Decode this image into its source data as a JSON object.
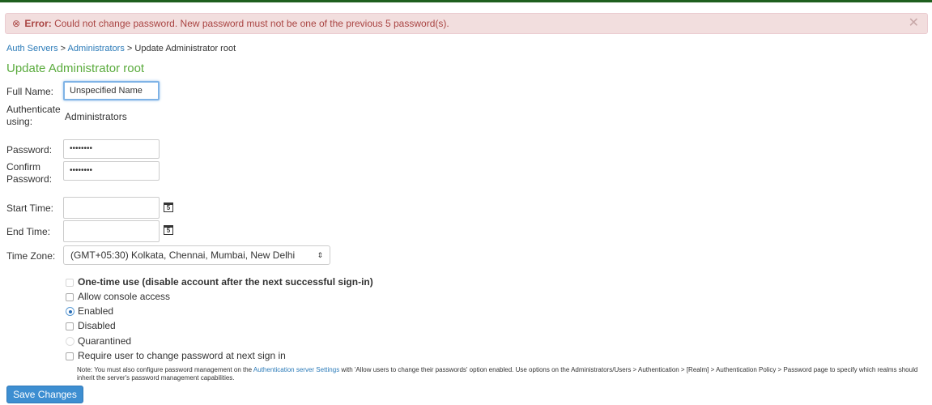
{
  "error": {
    "icon": "error-circle-icon",
    "prefix": "Error:",
    "message": "Could not change password. New password must not be one of the previous 5 password(s).",
    "close_icon": "close-icon"
  },
  "breadcrumb": {
    "items": [
      "Auth Servers",
      "Administrators"
    ],
    "separator": ">",
    "current": "Update Administrator root"
  },
  "page_title": "Update Administrator root",
  "form": {
    "full_name": {
      "label": "Full Name:",
      "value": "Unspecified Name"
    },
    "authenticate": {
      "label_line1": "Authenticate",
      "label_line2": "using:",
      "value": "Administrators"
    },
    "password": {
      "label": "Password:",
      "masked": "••••••••"
    },
    "confirm_password": {
      "label_line1": "Confirm",
      "label_line2": "Password:",
      "masked": "••••••••"
    },
    "start_time": {
      "label": "Start Time:",
      "value": "",
      "calendar_label": "5"
    },
    "end_time": {
      "label": "End Time:",
      "value": "",
      "calendar_label": "5"
    },
    "time_zone": {
      "label": "Time Zone:",
      "selected": "(GMT+05:30) Kolkata, Chennai, Mumbai, New Delhi"
    }
  },
  "options": {
    "one_time_use": "One-time use (disable account after the next successful sign-in)",
    "allow_console": "Allow console access",
    "enabled": "Enabled",
    "disabled": "Disabled",
    "quarantined": "Quarantined",
    "require_change": "Require user to change password at next sign in"
  },
  "note": {
    "before_link": "Note: You must also configure password management on the ",
    "link": "Authentication server Settings",
    "after_link": " with 'Allow users to change their passwords' option enabled. Use options on the Administrators/Users > Authentication > [Realm] > Authentication Policy > Password page to specify which realms should inherit the server's password management capabilities."
  },
  "save_button": "Save Changes",
  "colors": {
    "error_bg": "#f2dede",
    "error_text": "#a94442",
    "title_green": "#5aab3d",
    "link_blue": "#2a7ab8",
    "button_blue": "#3d8ed1"
  }
}
